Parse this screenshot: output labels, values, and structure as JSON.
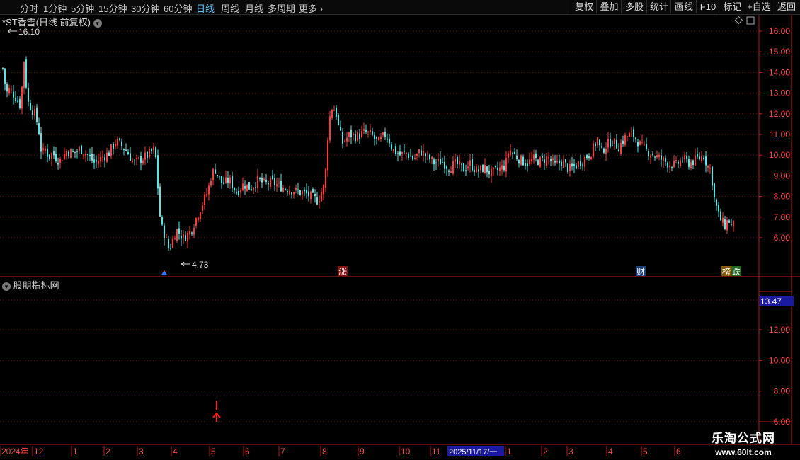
{
  "toolbar": {
    "periods": [
      {
        "label": "分时",
        "active": false
      },
      {
        "label": "1分钟",
        "active": false
      },
      {
        "label": "5分钟",
        "active": false
      },
      {
        "label": "15分钟",
        "active": false
      },
      {
        "label": "30分钟",
        "active": false
      },
      {
        "label": "60分钟",
        "active": false
      },
      {
        "label": "日线",
        "active": true
      },
      {
        "label": "周线",
        "active": false
      },
      {
        "label": "月线",
        "active": false
      },
      {
        "label": "多周期",
        "active": false
      },
      {
        "label": "更多",
        "active": false
      }
    ],
    "buttons": [
      "复权",
      "叠加",
      "多股",
      "统计",
      "画线",
      "F10",
      "标记",
      "+自选",
      "返回"
    ]
  },
  "main_chart": {
    "title": "*ST香雪(日线 前复权)",
    "high_label": "16.10",
    "low_label": "4.73",
    "y_ticks": [
      "16.00",
      "15.00",
      "14.00",
      "13.00",
      "12.00",
      "11.00",
      "10.00",
      "9.00",
      "8.00",
      "7.00",
      "6.00"
    ],
    "markers": {
      "zhang": "涨",
      "cai": "财",
      "bang": "榜",
      "die": "跌"
    },
    "colors": {
      "up": "#ff3a3a",
      "down": "#54e8e8",
      "grid": "#8a1010",
      "axis": "#c01818"
    }
  },
  "sub_chart": {
    "title": "股朋指标网",
    "current_value": "13.47",
    "y_ticks": [
      "12.00",
      "10.00",
      "8.00",
      "6.00"
    ]
  },
  "x_axis": {
    "labels": [
      "2024年",
      "12",
      "1",
      "2",
      "3",
      "4",
      "5",
      "6",
      "7",
      "8",
      "9",
      "10",
      "11",
      "1",
      "2",
      "3",
      "4",
      "5",
      "6"
    ],
    "cursor_date": "2025/11/17/一"
  },
  "watermark": {
    "line1": "乐淘公式网",
    "line2": "www.60lt.com"
  },
  "chart_data": {
    "type": "candlestick",
    "ylim": [
      4.5,
      16.6
    ],
    "sub_ylim": [
      5.8,
      15.2
    ],
    "x_axis_labels": [
      "2024年",
      "12",
      "1",
      "2",
      "3",
      "4",
      "5",
      "6",
      "7",
      "8",
      "9",
      "10",
      "11",
      "1",
      "2",
      "3",
      "4",
      "5",
      "6"
    ],
    "close_path": [
      [
        0,
        14.2
      ],
      [
        5,
        13.0
      ],
      [
        10,
        13.2
      ],
      [
        20,
        12.7
      ],
      [
        25,
        12.4
      ],
      [
        30,
        14.6
      ],
      [
        35,
        12.6
      ],
      [
        45,
        12.0
      ],
      [
        50,
        11.4
      ],
      [
        55,
        10.0
      ],
      [
        60,
        10.3
      ],
      [
        65,
        9.9
      ],
      [
        70,
        10.1
      ],
      [
        80,
        9.7
      ],
      [
        90,
        10.2
      ],
      [
        100,
        10.1
      ],
      [
        110,
        10.3
      ],
      [
        120,
        10.0
      ],
      [
        130,
        9.6
      ],
      [
        140,
        9.9
      ],
      [
        150,
        10.1
      ],
      [
        160,
        10.7
      ],
      [
        175,
        10.2
      ],
      [
        185,
        9.6
      ],
      [
        195,
        9.8
      ],
      [
        205,
        10.0
      ],
      [
        215,
        10.3
      ],
      [
        223,
        6.6
      ],
      [
        228,
        6.2
      ],
      [
        235,
        5.4
      ],
      [
        240,
        5.9
      ],
      [
        245,
        6.4
      ],
      [
        255,
        6.0
      ],
      [
        265,
        6.3
      ],
      [
        270,
        6.7
      ],
      [
        280,
        7.5
      ],
      [
        290,
        8.3
      ],
      [
        295,
        9.1
      ],
      [
        300,
        9.3
      ],
      [
        310,
        8.6
      ],
      [
        320,
        8.8
      ],
      [
        330,
        8.2
      ],
      [
        340,
        8.6
      ],
      [
        350,
        8.4
      ],
      [
        360,
        8.8
      ],
      [
        370,
        8.6
      ],
      [
        380,
        8.7
      ],
      [
        390,
        8.5
      ],
      [
        400,
        8.4
      ],
      [
        410,
        8.3
      ],
      [
        420,
        8.2
      ],
      [
        430,
        8.1
      ],
      [
        440,
        7.9
      ],
      [
        445,
        7.8
      ],
      [
        455,
        8.6
      ],
      [
        458,
        10.5
      ],
      [
        461,
        11.7
      ],
      [
        465,
        12.3
      ],
      [
        470,
        12.2
      ],
      [
        475,
        11.2
      ],
      [
        480,
        10.6
      ],
      [
        490,
        11.0
      ],
      [
        500,
        10.9
      ],
      [
        510,
        11.1
      ],
      [
        520,
        11.0
      ],
      [
        530,
        10.6
      ],
      [
        540,
        11.0
      ],
      [
        545,
        10.8
      ],
      [
        550,
        10.3
      ],
      [
        560,
        10.0
      ],
      [
        570,
        10.1
      ],
      [
        580,
        9.8
      ],
      [
        590,
        10.2
      ],
      [
        600,
        9.9
      ],
      [
        610,
        9.6
      ],
      [
        620,
        9.7
      ],
      [
        630,
        9.4
      ],
      [
        640,
        9.6
      ],
      [
        650,
        9.3
      ],
      [
        660,
        9.6
      ],
      [
        670,
        9.2
      ],
      [
        680,
        9.4
      ],
      [
        690,
        9.1
      ],
      [
        700,
        9.3
      ],
      [
        710,
        9.5
      ],
      [
        715,
        10.3
      ],
      [
        720,
        10.1
      ],
      [
        730,
        9.8
      ],
      [
        740,
        9.6
      ],
      [
        750,
        9.8
      ],
      [
        760,
        9.7
      ],
      [
        770,
        9.9
      ],
      [
        780,
        9.5
      ],
      [
        790,
        9.7
      ],
      [
        800,
        9.3
      ],
      [
        810,
        9.5
      ],
      [
        820,
        9.8
      ],
      [
        830,
        10.1
      ],
      [
        835,
        10.4
      ],
      [
        840,
        10.8
      ],
      [
        845,
        10.1
      ],
      [
        850,
        10.4
      ],
      [
        860,
        10.7
      ],
      [
        870,
        10.4
      ],
      [
        880,
        10.9
      ],
      [
        890,
        11.0
      ],
      [
        900,
        10.5
      ],
      [
        910,
        10.2
      ],
      [
        920,
        10.0
      ],
      [
        930,
        9.8
      ],
      [
        940,
        9.6
      ],
      [
        950,
        9.5
      ],
      [
        960,
        9.8
      ],
      [
        970,
        9.6
      ],
      [
        980,
        9.8
      ],
      [
        990,
        10.0
      ],
      [
        995,
        9.5
      ],
      [
        1000,
        9.3
      ],
      [
        1005,
        7.9
      ],
      [
        1010,
        7.2
      ],
      [
        1015,
        6.8
      ],
      [
        1020,
        6.6
      ],
      [
        1025,
        6.9
      ],
      [
        1030,
        6.5
      ],
      [
        1035,
        6.8
      ]
    ]
  }
}
